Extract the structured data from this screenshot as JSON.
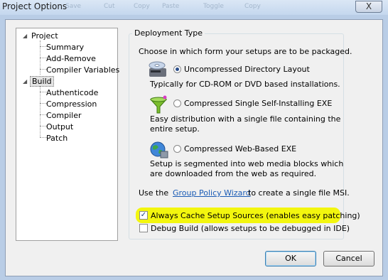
{
  "window": {
    "title": "Project Options",
    "close_symbol": "X",
    "background_toolbar": [
      "Save",
      "Cut",
      "Copy",
      "Paste",
      "Toggle",
      "Copy"
    ]
  },
  "tree": {
    "project": "Project",
    "project_children": [
      "Summary",
      "Add-Remove",
      "Compiler Variables"
    ],
    "build": "Build",
    "build_children": [
      "Authenticode",
      "Compression",
      "Compiler",
      "Output",
      "Patch"
    ]
  },
  "deployment": {
    "legend": "Deployment Type",
    "intro": "Choose in which form your setups are to be packaged.",
    "options": [
      {
        "label": "Uncompressed Directory Layout",
        "selected": true,
        "desc": [
          "Typically for CD-ROM or DVD based installations."
        ],
        "icon": "cd-drive-icon"
      },
      {
        "label": "Compressed Single Self-Installing EXE",
        "selected": false,
        "desc": [
          "Easy distribution with a single file containing the",
          "entire setup."
        ],
        "icon": "funnel-icon"
      },
      {
        "label": "Compressed Web-Based EXE",
        "selected": false,
        "desc": [
          "Setup is segmented into web media blocks which",
          "are downloaded from the web as required."
        ],
        "icon": "globe-icon"
      }
    ],
    "gp_prefix": "Use the",
    "gp_link": "Group Policy Wizard",
    "gp_suffix": "to create a single file MSI."
  },
  "checks": {
    "cache_label": "Always Cache Setup Sources (enables easy patching)",
    "cache_checked": true,
    "debug_label": "Debug Build (allows setups to be debugged in IDE)",
    "debug_checked": false,
    "highlight_color": "#f3f60e"
  },
  "buttons": {
    "ok": "OK",
    "cancel": "Cancel"
  }
}
